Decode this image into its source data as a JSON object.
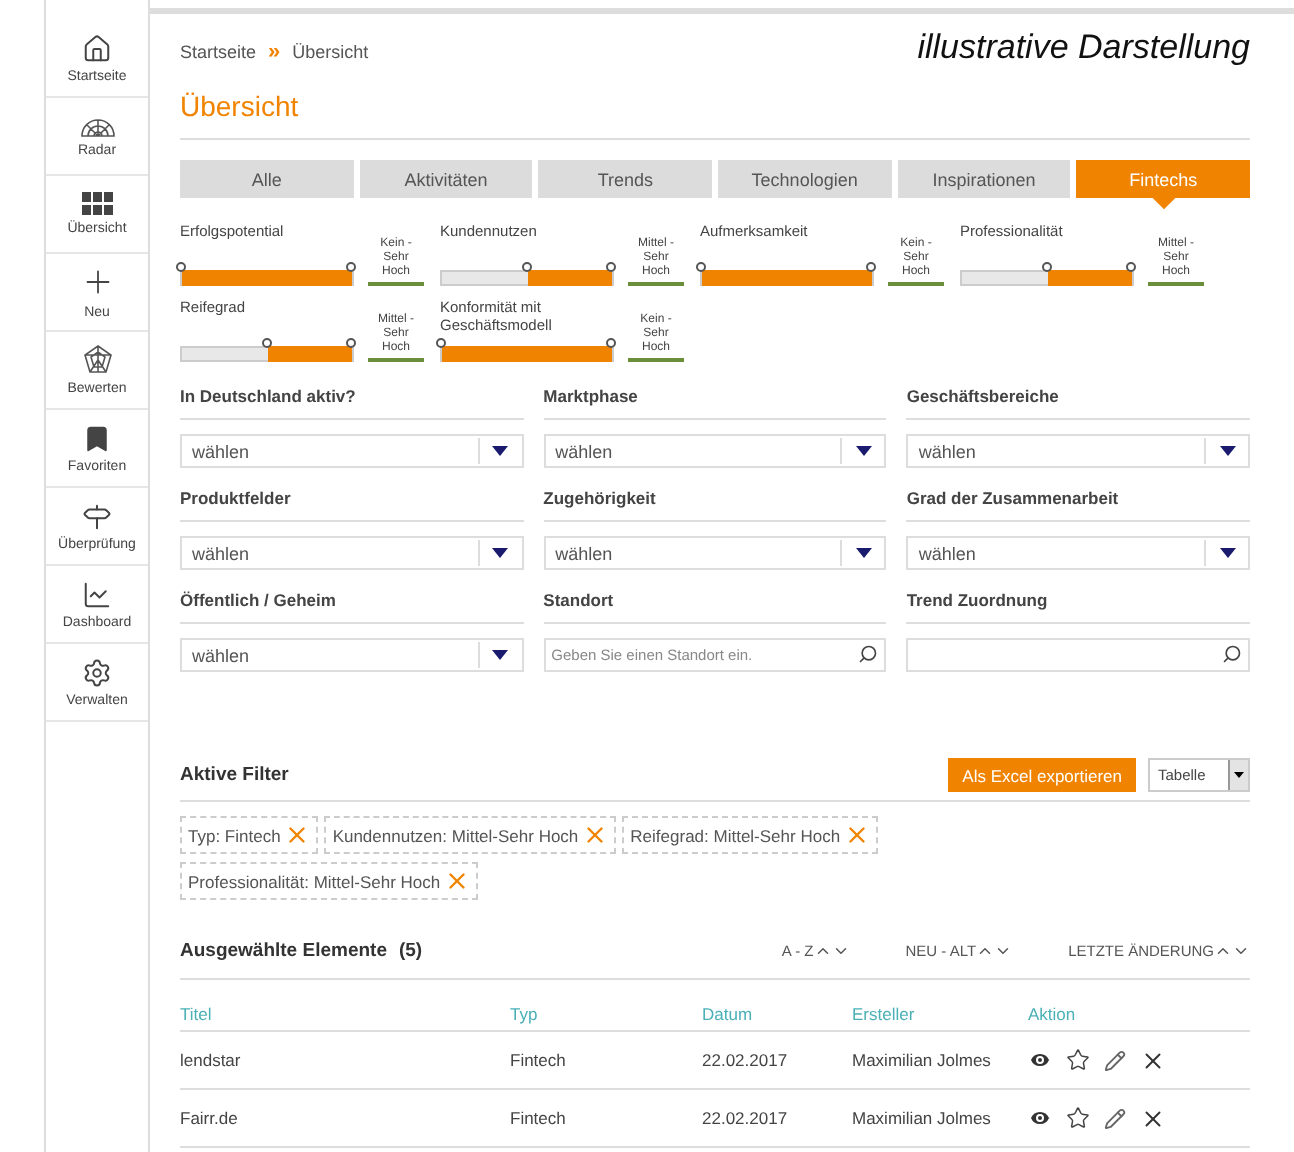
{
  "sidebar": {
    "items": [
      {
        "label": "Startseite",
        "kind": "home"
      },
      {
        "label": "Radar",
        "kind": "radar"
      },
      {
        "label": "Übersicht",
        "kind": "grid"
      },
      {
        "label": "Neu",
        "kind": "plus"
      },
      {
        "label": "Bewerten",
        "kind": "web"
      },
      {
        "label": "Favoriten",
        "kind": "bookmark"
      },
      {
        "label": "Überprüfung",
        "kind": "signpost"
      },
      {
        "label": "Dashboard",
        "kind": "chart"
      },
      {
        "label": "Verwalten",
        "kind": "gears"
      }
    ]
  },
  "breadcrumb": {
    "items": [
      "Startseite",
      "Übersicht"
    ],
    "separator": "»"
  },
  "note": "illustrative Darstellung",
  "title": "Übersicht",
  "tabs": [
    {
      "label": "Alle",
      "selected": false
    },
    {
      "label": "Aktivitäten",
      "selected": false
    },
    {
      "label": "Trends",
      "selected": false
    },
    {
      "label": "Technologien",
      "selected": false
    },
    {
      "label": "Inspirationen",
      "selected": false
    },
    {
      "label": "Fintechs",
      "selected": true
    }
  ],
  "ratings": [
    {
      "label": "Erfolgspotential",
      "level": 1,
      "range": "Kein - Sehr Hoch"
    },
    {
      "label": "Kundennutzen",
      "level": 0.5,
      "range": "Mittel - Sehr Hoch"
    },
    {
      "label": "Aufmerksamkeit",
      "level": 1,
      "range": "Kein - Sehr Hoch"
    },
    {
      "label": "Professionalität",
      "level": 0.5,
      "range": "Mittel - Sehr Hoch"
    },
    {
      "label": "Reifegrad",
      "level": 0.5,
      "range": "Mittel - Sehr Hoch"
    },
    {
      "label": "Konformität mit Geschäftsmodell",
      "level": 1,
      "range": "Kein - Sehr Hoch"
    }
  ],
  "filters": [
    {
      "label": "In Deutschland aktiv?",
      "kind": "select",
      "value": "wählen"
    },
    {
      "label": "Marktphase",
      "kind": "select",
      "value": "wählen"
    },
    {
      "label": "Geschäftsbereiche",
      "kind": "select",
      "value": "wählen"
    },
    {
      "label": "Produktfelder",
      "kind": "select",
      "value": "wählen"
    },
    {
      "label": "Zugehörigkeit",
      "kind": "select",
      "value": "wählen"
    },
    {
      "label": "Grad der Zusammenarbeit",
      "kind": "select",
      "value": "wählen"
    },
    {
      "label": "Öffentlich / Geheim",
      "kind": "select",
      "value": "wählen"
    },
    {
      "label": "Standort",
      "kind": "search",
      "placeholder": "Geben Sie einen Standort ein."
    },
    {
      "label": "Trend Zuordnung",
      "kind": "search"
    }
  ],
  "active_filters": {
    "title": "Aktive Filter",
    "export_button": "Als Excel exportieren",
    "view_select": "Tabelle",
    "chips": [
      "Typ: Fintech",
      "Kundennutzen: Mittel-Sehr Hoch",
      "Reifegrad: Mittel-Sehr Hoch",
      "Professionalität: Mittel-Sehr Hoch"
    ]
  },
  "results": {
    "title": "Ausgewählte Elemente",
    "count": "(5)",
    "sorts": [
      "A - Z",
      "NEU - ALT",
      "LETZTE ÄNDERUNG"
    ],
    "columns": [
      "Titel",
      "Typ",
      "Datum",
      "Ersteller",
      "Aktion"
    ],
    "rows": [
      {
        "cells": [
          "lendstar",
          "Fintech",
          "22.02.2017",
          "Maximilian Jolmes"
        ]
      },
      {
        "cells": [
          "Fairr.de",
          "Fintech",
          "22.02.2017",
          "Maximilian Jolmes"
        ]
      }
    ]
  }
}
